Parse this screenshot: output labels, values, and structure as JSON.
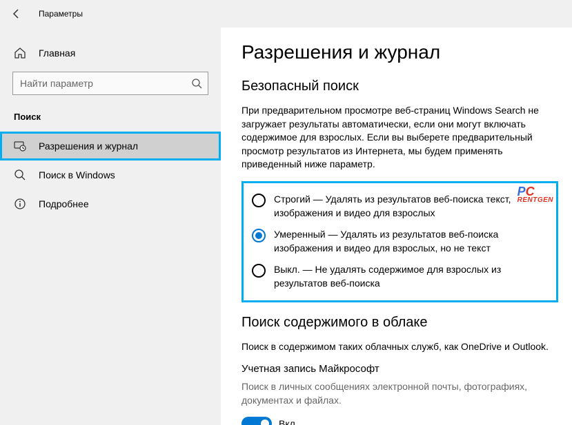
{
  "titlebar": {
    "title": "Параметры"
  },
  "sidebar": {
    "home_label": "Главная",
    "search_placeholder": "Найти параметр",
    "section_label": "Поиск",
    "items": [
      {
        "label": "Разрешения и журнал"
      },
      {
        "label": "Поиск в Windows"
      },
      {
        "label": "Подробнее"
      }
    ]
  },
  "content": {
    "page_title": "Разрешения и журнал",
    "safesearch": {
      "heading": "Безопасный поиск",
      "intro": "При предварительном просмотре веб-страниц Windows Search не загружает результаты автоматически, если они могут включать содержимое для взрослых. Если вы выберете предварительный просмотр результатов из Интернета, мы будем применять приведенный ниже параметр.",
      "options": [
        {
          "label": "Строгий — Удалять из результатов веб-поиска текст, изображения и видео для взрослых",
          "checked": false
        },
        {
          "label": "Умеренный — Удалять из результатов веб-поиска изображения и видео для взрослых, но не текст",
          "checked": true
        },
        {
          "label": "Выкл. — Не удалять содержимое для взрослых из результатов веб-поиска",
          "checked": false
        }
      ]
    },
    "cloud": {
      "heading": "Поиск содержимого в облаке",
      "intro": "Поиск в содержимом таких облачных служб, как OneDrive и Outlook.",
      "ms_account": {
        "title": "Учетная запись Майкрософт",
        "desc": "Поиск в личных сообщениях электронной почты, фотографиях, документах и файлах.",
        "toggle_label": "Вкл.",
        "toggle_on": true
      }
    }
  },
  "watermark": {
    "line1_a": "P",
    "line1_b": "C",
    "line2": "RENTGEN"
  }
}
